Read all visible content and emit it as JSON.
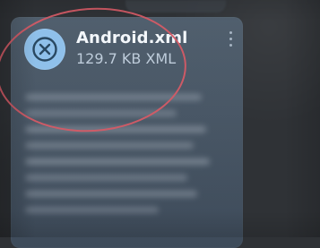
{
  "file": {
    "name": "Android.xml",
    "meta": "129.7 KB XML"
  },
  "icons": {
    "file_status": "cancel-download-icon",
    "menu": "more-vertical-icon"
  },
  "colors": {
    "background": "#2f3236",
    "card": "#4b5a69",
    "icon_fill": "#8fc0ea",
    "title_text": "#f3f7fb",
    "meta_text": "#c8d6e4",
    "annotation": "#d45b66"
  }
}
